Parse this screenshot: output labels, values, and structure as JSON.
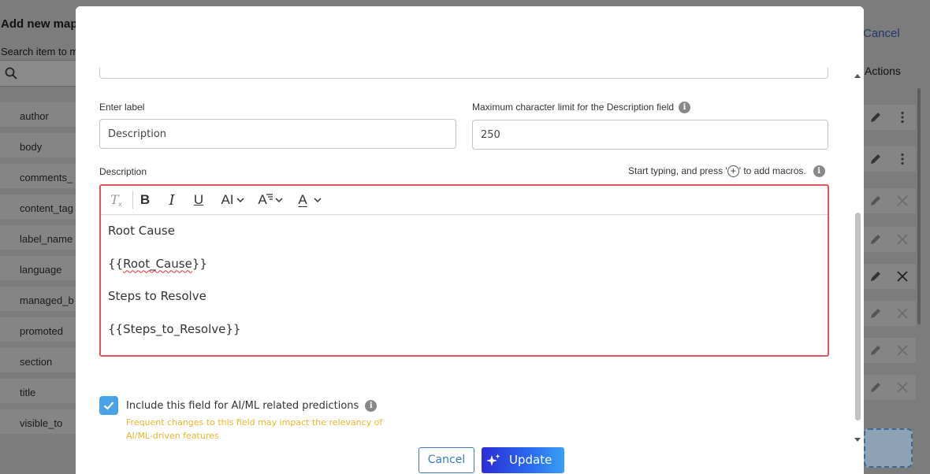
{
  "background": {
    "title": "Add new map",
    "search_label": "Search item to m",
    "items": [
      "author",
      "body",
      "comments_",
      "content_tag",
      "label_name",
      "language",
      "managed_b",
      "promoted",
      "section",
      "title",
      "visible_to"
    ],
    "cancel_label": "Cancel",
    "actions_label": "Actions"
  },
  "form": {
    "label_field_label": "Enter label",
    "label_value": "Description",
    "maxchar_label": "Maximum character limit for the Description field",
    "maxchar_value": "250",
    "description_label": "Description",
    "macro_hint_before": "Start typing, and press '",
    "macro_hint_after": "' to add macros."
  },
  "editor": {
    "toolbar": {
      "clear_format": "clear-format-icon",
      "bold": "B",
      "italic": "I",
      "underline": "U",
      "font_size": "AI",
      "line_height": "A",
      "font_color": "A"
    },
    "lines": [
      "Root Cause",
      "{{Root_Cause}}",
      "Steps to Resolve",
      "{{Steps_to_Resolve}}"
    ]
  },
  "ai_option": {
    "checked": true,
    "label": "Include this field for AI/ML related predictions",
    "warning": "Frequent changes to this field may impact the relevancy of AI/ML-driven features"
  },
  "buttons": {
    "cancel": "Cancel",
    "update": "Update"
  },
  "colors": {
    "editor_border": "#e0525c",
    "checkbox": "#4aa3e6",
    "warning": "#f0b429",
    "update_gradient_start": "#2b2cd6",
    "update_gradient_end": "#3aa0f5"
  }
}
